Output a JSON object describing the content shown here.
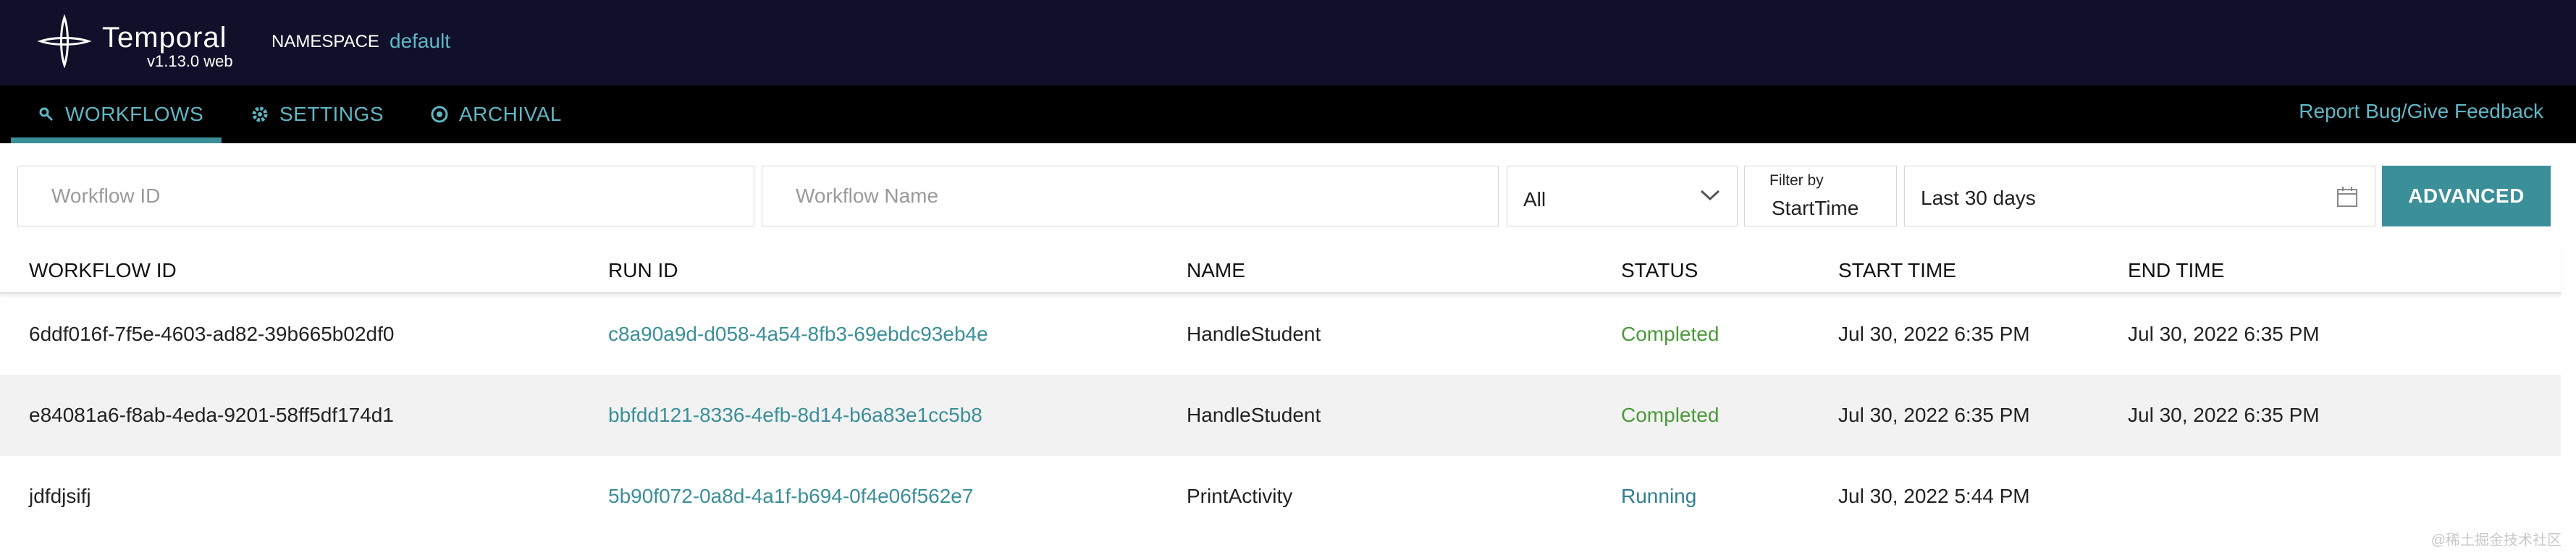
{
  "header": {
    "brand": "Temporal",
    "version": "v1.13.0 web",
    "namespace_label": "NAMESPACE",
    "namespace_value": "default",
    "logo_icon": "temporal-logo-icon"
  },
  "nav": {
    "tabs": [
      {
        "label": "WORKFLOWS",
        "icon": "search-icon",
        "active": true
      },
      {
        "label": "SETTINGS",
        "icon": "gear-icon",
        "active": false
      },
      {
        "label": "ARCHIVAL",
        "icon": "archive-icon",
        "active": false
      }
    ],
    "feedback_label": "Report Bug/Give Feedback"
  },
  "filters": {
    "workflow_id_placeholder": "Workflow ID",
    "workflow_name_placeholder": "Workflow Name",
    "status_selected": "All",
    "filter_by_label": "Filter by",
    "filter_by_value": "StartTime",
    "date_range": "Last 30 days",
    "advanced_label": "ADVANCED"
  },
  "table": {
    "columns": [
      "WORKFLOW ID",
      "RUN ID",
      "NAME",
      "STATUS",
      "START TIME",
      "END TIME"
    ],
    "rows": [
      {
        "workflow_id": "6ddf016f-7f5e-4603-ad82-39b665b02df0",
        "run_id": "c8a90a9d-d058-4a54-8fb3-69ebdc93eb4e",
        "name": "HandleStudent",
        "status": "Completed",
        "start_time": "Jul 30, 2022 6:35 PM",
        "end_time": "Jul 30, 2022 6:35 PM"
      },
      {
        "workflow_id": "e84081a6-f8ab-4eda-9201-58ff5df174d1",
        "run_id": "bbfdd121-8336-4efb-8d14-b6a83e1cc5b8",
        "name": "HandleStudent",
        "status": "Completed",
        "start_time": "Jul 30, 2022 6:35 PM",
        "end_time": "Jul 30, 2022 6:35 PM"
      },
      {
        "workflow_id": "jdfdjsifj",
        "run_id": "5b90f072-0a8d-4a1f-b694-0f4e06f562e7",
        "name": "PrintActivity",
        "status": "Running",
        "start_time": "Jul 30, 2022 5:44 PM",
        "end_time": ""
      }
    ]
  },
  "watermark": "@稀土掘金技术社区",
  "colors": {
    "accent": "#3b8f98",
    "header_bg": "#11102a",
    "nav_bg": "#000000",
    "completed": "#4a9a3a"
  }
}
